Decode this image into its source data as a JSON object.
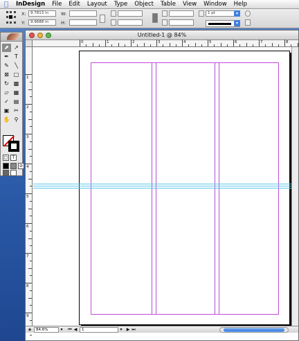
{
  "menubar": {
    "app": "InDesign",
    "items": [
      "File",
      "Edit",
      "Layout",
      "Type",
      "Object",
      "Table",
      "View",
      "Window",
      "Help"
    ]
  },
  "control": {
    "x_label": "X:",
    "x_value": "9.7813 in",
    "y_label": "Y:",
    "y_value": "9.9688 in",
    "w_label": "W:",
    "h_label": "H:",
    "stroke_weight": "1 pt"
  },
  "document": {
    "title": "Untitled-1 @ 84%",
    "zoom": "84.6%",
    "page": "1"
  },
  "rulers": {
    "h_numbers": [
      "0",
      "1",
      "2",
      "3",
      "4",
      "5",
      "6",
      "7",
      "8"
    ],
    "v_numbers": [
      "1",
      "2",
      "3",
      "4",
      "5",
      "6",
      "7",
      "8",
      "9"
    ]
  },
  "colors": {
    "margin_guide": "#c24ad8",
    "column_guide": "#b050d6",
    "ruler_guide": "#5dc8e8",
    "scroll_accent": "#3b7fe0"
  }
}
